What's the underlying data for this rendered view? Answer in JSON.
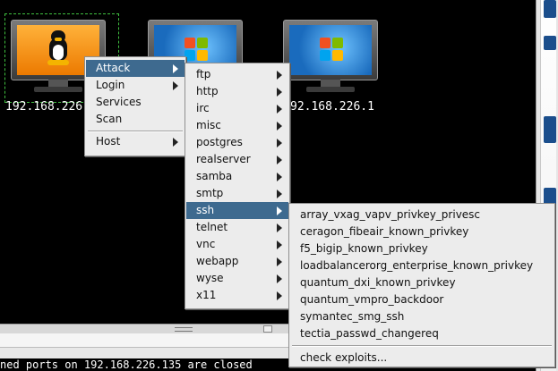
{
  "hosts": [
    {
      "ip": "192.168.226",
      "os_icon": "linux-tux-icon",
      "selected": true
    },
    {
      "ip": "",
      "os_icon": "windows-logo-icon",
      "selected": false
    },
    {
      "ip": "92.168.226.1",
      "os_icon": "windows-logo-icon",
      "selected": false
    }
  ],
  "context_menu": {
    "items": [
      {
        "label": "Attack",
        "submenu": true
      },
      {
        "label": "Login",
        "submenu": true
      },
      {
        "label": "Services",
        "submenu": false
      },
      {
        "label": "Scan",
        "submenu": false
      },
      {
        "label": "Host",
        "submenu": true
      }
    ]
  },
  "attack_menu": {
    "items": [
      "ftp",
      "http",
      "irc",
      "misc",
      "postgres",
      "realserver",
      "samba",
      "smtp",
      "ssh",
      "telnet",
      "vnc",
      "webapp",
      "wyse",
      "x11"
    ],
    "selected": "ssh"
  },
  "ssh_menu": {
    "items": [
      "array_vxag_vapv_privkey_privesc",
      "ceragon_fibeair_known_privkey",
      "f5_bigip_known_privkey",
      "loadbalancerorg_enterprise_known_privkey",
      "quantum_dxi_known_privkey",
      "quantum_vmpro_backdoor",
      "symantec_smg_ssh",
      "tectia_passwd_changereq"
    ],
    "check_exploits": "check exploits..."
  },
  "status_line": "ned ports on 192.168.226.135 are closed",
  "colors": {
    "menu_bg": "#ececec",
    "highlight": "#3e6a8f",
    "selection_border": "#3fbf3f",
    "linux_screen": "#f28a00"
  }
}
